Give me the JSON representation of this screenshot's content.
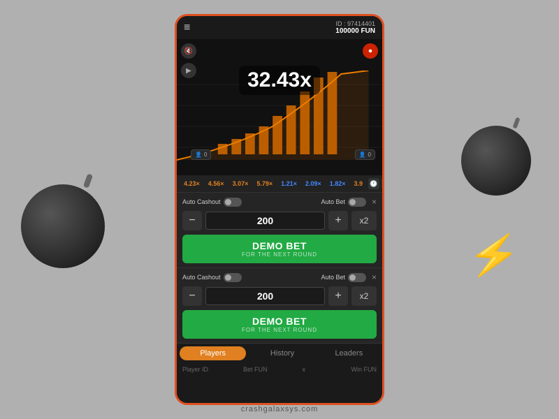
{
  "header": {
    "user_id_label": "ID : 97414401",
    "balance": "100000 FUN",
    "menu_icon": "≡"
  },
  "game": {
    "multiplier": "32.43x"
  },
  "history": {
    "items": [
      {
        "value": "4.23×",
        "color": "hist-orange"
      },
      {
        "value": "4.56×",
        "color": "hist-orange"
      },
      {
        "value": "3.07×",
        "color": "hist-orange"
      },
      {
        "value": "5.79×",
        "color": "hist-orange"
      },
      {
        "value": "1.21×",
        "color": "hist-blue"
      },
      {
        "value": "2.09×",
        "color": "hist-blue"
      },
      {
        "value": "1.82×",
        "color": "hist-blue"
      },
      {
        "value": "3.9",
        "color": "hist-orange"
      }
    ]
  },
  "bet_panel_1": {
    "auto_cashout_label": "Auto Cashout",
    "auto_bet_label": "Auto Bet",
    "minus_label": "−",
    "plus_label": "+",
    "value": "200",
    "x2_label": "x2",
    "demo_bet_main": "DEMO BET",
    "demo_bet_sub": "FOR THE NEXT ROUND"
  },
  "bet_panel_2": {
    "auto_cashout_label": "Auto Cashout",
    "auto_bet_label": "Auto Bet",
    "minus_label": "−",
    "plus_label": "+",
    "value": "200",
    "x2_label": "x2",
    "demo_bet_main": "DEMO BET",
    "demo_bet_sub": "FOR THE NEXT ROUND"
  },
  "tabs": {
    "players_label": "Players",
    "history_label": "History",
    "leaders_label": "Leaders"
  },
  "table": {
    "col1": "Player ID",
    "col2": "Bet  FUN",
    "col3": "x",
    "col4": "Win  FUN"
  },
  "footer": {
    "text": "crashgalaxsys.com"
  },
  "buttons": {
    "mute": "🔇",
    "record": "⏺",
    "play": "▶"
  },
  "bet_indicators": {
    "left": "0",
    "right": "0"
  }
}
